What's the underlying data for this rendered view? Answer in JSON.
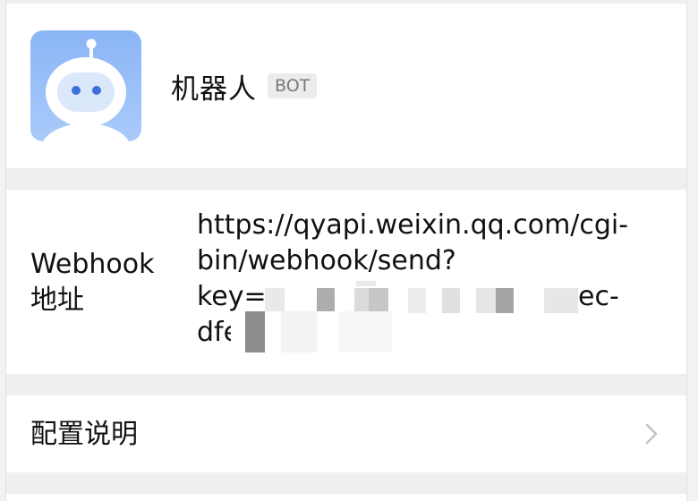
{
  "bot": {
    "name": "机器人",
    "tag": "BOT",
    "avatar_icon": "robot-icon"
  },
  "webhook": {
    "label_line1": "Webhook",
    "label_line2": "地址",
    "url_line1": "https://qyapi.weixin.qq.com/cgi-",
    "url_line2": "bin/webhook/send?",
    "url_line3": "key=",
    "url_line3_end": "ec-",
    "url_line4": "dfe"
  },
  "config": {
    "label": "配置说明",
    "chevron_icon": "chevron-right-icon"
  },
  "colors": {
    "avatar_bg": "#8bb5f6",
    "tag_bg": "#ececec",
    "tag_text": "#7a7a7a",
    "chevron": "#c4c4c4",
    "section_gap": "#efeff1"
  }
}
